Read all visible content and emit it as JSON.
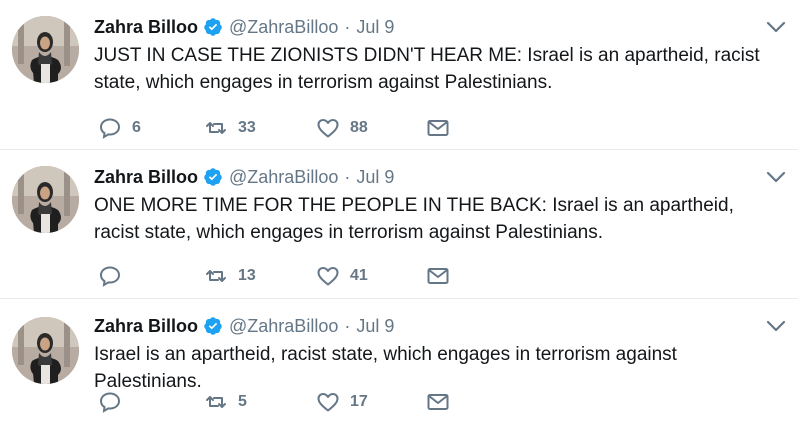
{
  "colors": {
    "text": "#14171a",
    "secondary": "#657786",
    "verified": "#1da1f2",
    "divider": "#e6ecf0"
  },
  "icons": {
    "verified": "verified-badge-icon",
    "caret": "chevron-down-icon",
    "reply": "reply-icon",
    "retweet": "retweet-icon",
    "like": "heart-icon",
    "dm": "envelope-icon"
  },
  "tweets": [
    {
      "name": "Zahra Billoo",
      "handle": "@ZahraBilloo",
      "separator": "·",
      "time": "Jul 9",
      "text": "JUST IN CASE THE ZIONISTS DIDN'T HEAR ME: Israel is an apartheid, racist state, which engages in terrorism against Palestinians.",
      "replies": "6",
      "retweets": "33",
      "likes": "88"
    },
    {
      "name": "Zahra Billoo",
      "handle": "@ZahraBilloo",
      "separator": "·",
      "time": "Jul 9",
      "text": "ONE MORE TIME FOR THE PEOPLE IN THE BACK: Israel is an apartheid, racist state, which engages in terrorism against Palestinians.",
      "replies": "",
      "retweets": "13",
      "likes": "41"
    },
    {
      "name": "Zahra Billoo",
      "handle": "@ZahraBilloo",
      "separator": "·",
      "time": "Jul 9",
      "text": "Israel is an apartheid, racist state, which engages in terrorism against Palestinians.",
      "replies": "",
      "retweets": "5",
      "likes": "17"
    }
  ]
}
